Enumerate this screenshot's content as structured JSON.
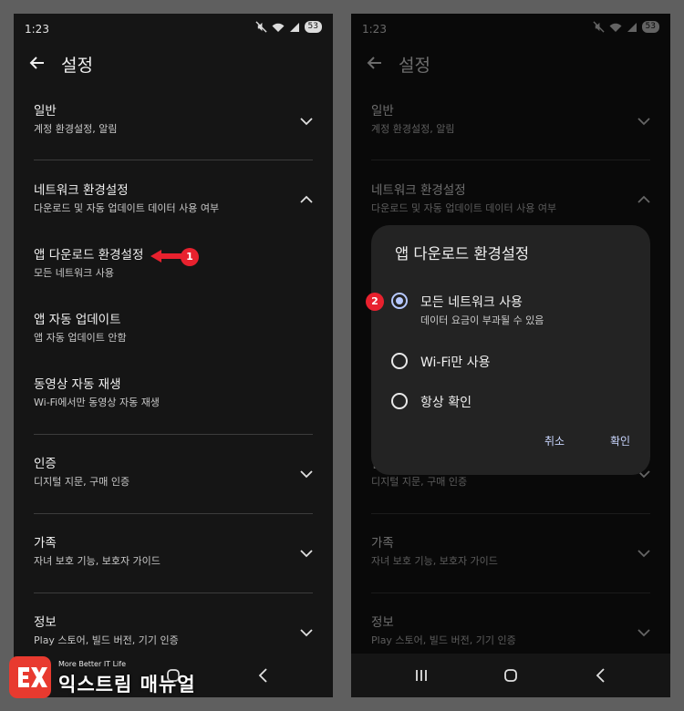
{
  "colors": {
    "accent": "#b6c8ff",
    "badge": "#e8212e",
    "panel": "#151515",
    "dialog": "#232323"
  },
  "status_bar": {
    "time": "1:23",
    "battery": "53",
    "icons": [
      "mute-icon",
      "wifi-icon",
      "signal-icon",
      "battery-icon"
    ]
  },
  "app_bar": {
    "title": "설정",
    "back_icon": "arrow-left-icon"
  },
  "settings": {
    "general": {
      "title": "일반",
      "subtitle": "계정 환경설정, 알림"
    },
    "network": {
      "title": "네트워크 환경설정",
      "subtitle": "다운로드 및 자동 업데이트 데이터 사용 여부"
    },
    "app_download": {
      "title": "앱 다운로드 환경설정",
      "subtitle": "모든 네트워크 사용"
    },
    "auto_update": {
      "title": "앱 자동 업데이트",
      "subtitle": "앱 자동 업데이트 안함"
    },
    "video_autoplay": {
      "title": "동영상 자동 재생",
      "subtitle": "Wi-Fi에서만 동영상 자동 재생"
    },
    "auth": {
      "title": "인증",
      "subtitle": "디지털 지문, 구매 인증"
    },
    "family": {
      "title": "가족",
      "subtitle": "자녀 보호 기능, 보호자 가이드"
    },
    "info": {
      "title": "정보",
      "subtitle": "Play 스토어, 빌드 버전, 기기 인증"
    }
  },
  "dialog": {
    "title": "앱 다운로드 환경설정",
    "options": [
      {
        "label": "모든 네트워크 사용",
        "sublabel": "데이터 요금이 부과될 수 있음",
        "selected": true
      },
      {
        "label": "Wi-Fi만 사용",
        "selected": false
      },
      {
        "label": "항상 확인",
        "selected": false
      }
    ],
    "cancel": "취소",
    "confirm": "확인"
  },
  "annotations": {
    "step1": "1",
    "step2": "2"
  },
  "watermark": {
    "tagline": "More Better IT Life",
    "name": "익스트림 매뉴얼"
  },
  "nav_bar": [
    "recents-icon",
    "home-icon",
    "back-icon"
  ]
}
